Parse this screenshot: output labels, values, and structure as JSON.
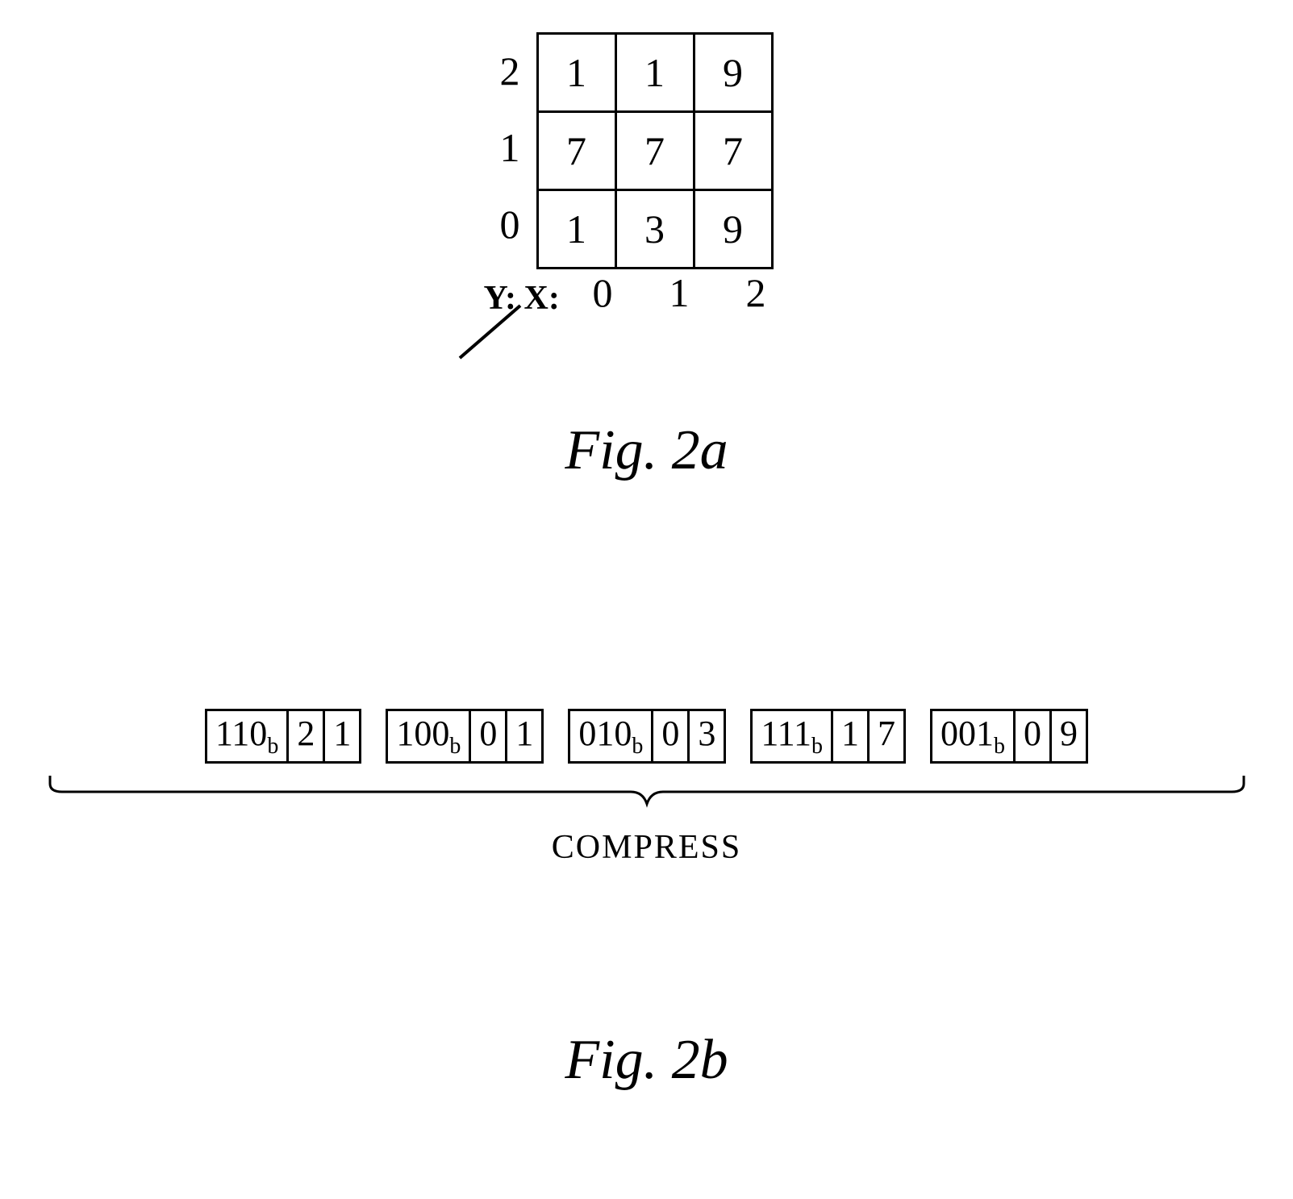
{
  "fig2a": {
    "yAxisLabel": "Y:",
    "xAxisLabel": "X:",
    "yLabels": [
      "2",
      "1",
      "0"
    ],
    "xLabels": [
      "0",
      "1",
      "2"
    ],
    "grid": [
      [
        "1",
        "1",
        "9"
      ],
      [
        "7",
        "7",
        "7"
      ],
      [
        "1",
        "3",
        "9"
      ]
    ],
    "caption": "Fig. 2a"
  },
  "fig2b": {
    "tuples": [
      {
        "binary": "110",
        "sub": "b",
        "val1": "2",
        "val2": "1"
      },
      {
        "binary": "100",
        "sub": "b",
        "val1": "0",
        "val2": "1"
      },
      {
        "binary": "010",
        "sub": "b",
        "val1": "0",
        "val2": "3"
      },
      {
        "binary": "111",
        "sub": "b",
        "val1": "1",
        "val2": "7"
      },
      {
        "binary": "001",
        "sub": "b",
        "val1": "0",
        "val2": "9"
      }
    ],
    "compressLabel": "COMPRESS",
    "caption": "Fig. 2b"
  }
}
